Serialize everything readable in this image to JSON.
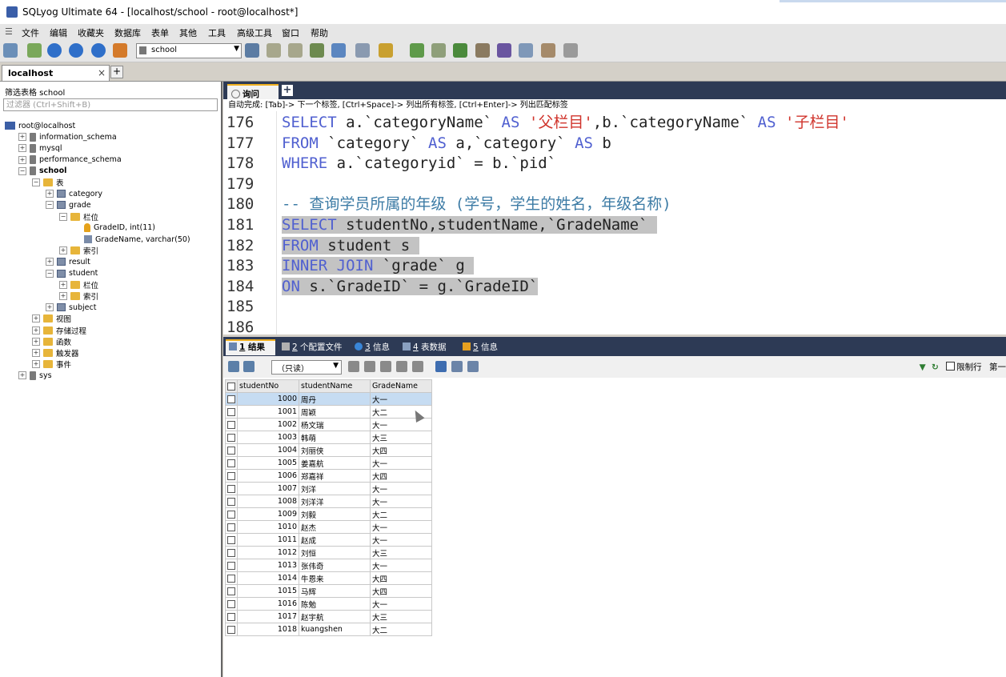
{
  "window": {
    "title": "SQLyog Ultimate 64 - [localhost/school - root@localhost*]"
  },
  "menu": [
    "文件",
    "编辑",
    "收藏夹",
    "数据库",
    "表单",
    "其他",
    "工具",
    "高级工具",
    "窗口",
    "帮助"
  ],
  "toolbar": {
    "database_select": "school"
  },
  "connection_tab": {
    "label": "localhost",
    "close": "×",
    "add": "+"
  },
  "object_browser": {
    "filter_label": "筛选表格 school",
    "filter_placeholder": "过滤器 (Ctrl+Shift+B)",
    "tree": [
      {
        "label": "root@localhost",
        "type": "server",
        "level": 0,
        "expander": "",
        "bold": false
      },
      {
        "label": "information_schema",
        "type": "db",
        "level": 1,
        "expander": "+",
        "bold": false
      },
      {
        "label": "mysql",
        "type": "db",
        "level": 1,
        "expander": "+",
        "bold": false
      },
      {
        "label": "performance_schema",
        "type": "db",
        "level": 1,
        "expander": "+",
        "bold": false
      },
      {
        "label": "school",
        "type": "db",
        "level": 1,
        "expander": "−",
        "bold": true
      },
      {
        "label": "表",
        "type": "folder",
        "level": 2,
        "expander": "−",
        "bold": false
      },
      {
        "label": "category",
        "type": "table",
        "level": 3,
        "expander": "+",
        "bold": false
      },
      {
        "label": "grade",
        "type": "table",
        "level": 3,
        "expander": "−",
        "bold": false
      },
      {
        "label": "栏位",
        "type": "folder",
        "level": 4,
        "expander": "−",
        "bold": false
      },
      {
        "label": "GradeID, int(11)",
        "type": "key",
        "level": 5,
        "expander": "",
        "bold": false
      },
      {
        "label": "GradeName, varchar(50)",
        "type": "col",
        "level": 5,
        "expander": "",
        "bold": false
      },
      {
        "label": "索引",
        "type": "folder",
        "level": 4,
        "expander": "+",
        "bold": false
      },
      {
        "label": "result",
        "type": "table",
        "level": 3,
        "expander": "+",
        "bold": false
      },
      {
        "label": "student",
        "type": "table",
        "level": 3,
        "expander": "−",
        "bold": false
      },
      {
        "label": "栏位",
        "type": "folder",
        "level": 4,
        "expander": "+",
        "bold": false
      },
      {
        "label": "索引",
        "type": "folder",
        "level": 4,
        "expander": "+",
        "bold": false
      },
      {
        "label": "subject",
        "type": "table",
        "level": 3,
        "expander": "+",
        "bold": false
      },
      {
        "label": "视图",
        "type": "folder",
        "level": 2,
        "expander": "+",
        "bold": false
      },
      {
        "label": "存储过程",
        "type": "folder",
        "level": 2,
        "expander": "+",
        "bold": false
      },
      {
        "label": "函数",
        "type": "folder",
        "level": 2,
        "expander": "+",
        "bold": false
      },
      {
        "label": "触发器",
        "type": "folder",
        "level": 2,
        "expander": "+",
        "bold": false
      },
      {
        "label": "事件",
        "type": "folder",
        "level": 2,
        "expander": "+",
        "bold": false
      },
      {
        "label": "sys",
        "type": "db",
        "level": 1,
        "expander": "+",
        "bold": false
      }
    ]
  },
  "query_tab": {
    "label": "询问",
    "add": "+"
  },
  "autocomplete_hint": "自动完成: [Tab]-> 下一个标签, [Ctrl+Space]-> 列出所有标签, [Ctrl+Enter]-> 列出匹配标签",
  "editor": {
    "lines": [
      {
        "no": "176",
        "sel": false,
        "tokens": [
          [
            "kw",
            "SELECT "
          ],
          [
            "txt",
            "a.`categoryName` "
          ],
          [
            "kw",
            "AS "
          ],
          [
            "str",
            "'父栏目'"
          ],
          [
            "txt",
            ",b.`categoryName` "
          ],
          [
            "kw",
            "AS "
          ],
          [
            "str",
            "'子栏目'"
          ]
        ]
      },
      {
        "no": "177",
        "sel": false,
        "tokens": [
          [
            "kw",
            "FROM "
          ],
          [
            "txt",
            "`category` "
          ],
          [
            "kw",
            "AS "
          ],
          [
            "txt",
            "a,`category` "
          ],
          [
            "kw",
            "AS "
          ],
          [
            "txt",
            "b"
          ]
        ]
      },
      {
        "no": "178",
        "sel": false,
        "tokens": [
          [
            "kw",
            "WHERE "
          ],
          [
            "txt",
            "a.`categoryid` = b.`pid`"
          ]
        ]
      },
      {
        "no": "179",
        "sel": false,
        "tokens": []
      },
      {
        "no": "180",
        "sel": false,
        "tokens": [
          [
            "cmt",
            "-- 查询学员所属的年级 (学号，学生的姓名，年级名称)"
          ]
        ]
      },
      {
        "no": "181",
        "sel": true,
        "tokens": [
          [
            "kw",
            "SELECT "
          ],
          [
            "txt",
            "studentNo,studentName,`GradeName` "
          ]
        ]
      },
      {
        "no": "182",
        "sel": true,
        "tokens": [
          [
            "kw",
            "FROM "
          ],
          [
            "txt",
            "student s "
          ]
        ]
      },
      {
        "no": "183",
        "sel": true,
        "tokens": [
          [
            "kw",
            "INNER JOIN "
          ],
          [
            "txt",
            "`grade` g "
          ]
        ]
      },
      {
        "no": "184",
        "sel": true,
        "tokens": [
          [
            "kw",
            "ON "
          ],
          [
            "txt",
            "s.`GradeID` = g.`GradeID`"
          ]
        ]
      },
      {
        "no": "185",
        "sel": false,
        "tokens": []
      },
      {
        "no": "186",
        "sel": false,
        "tokens": []
      }
    ]
  },
  "result_tabs": [
    {
      "num": "1",
      "label": " 结果",
      "active": true
    },
    {
      "num": "2",
      "label": " 个配置文件",
      "active": false
    },
    {
      "num": "3",
      "label": " 信息",
      "active": false
    },
    {
      "num": "4",
      "label": " 表数据",
      "active": false
    },
    {
      "num": "5",
      "label": " 信息",
      "active": false
    }
  ],
  "result_toolbar": {
    "mode": "（只读）",
    "limit_label": "限制行",
    "first_label": "第一"
  },
  "result_grid": {
    "columns": [
      "studentNo",
      "studentName",
      "GradeName"
    ],
    "rows": [
      [
        "1000",
        "周丹",
        "大一"
      ],
      [
        "1001",
        "周颖",
        "大二"
      ],
      [
        "1002",
        "杨文瑞",
        "大一"
      ],
      [
        "1003",
        "韩萌",
        "大三"
      ],
      [
        "1004",
        "刘丽侠",
        "大四"
      ],
      [
        "1005",
        "姜嘉航",
        "大一"
      ],
      [
        "1006",
        "郑嘉祥",
        "大四"
      ],
      [
        "1007",
        "刘洋",
        "大一"
      ],
      [
        "1008",
        "刘洋洋",
        "大一"
      ],
      [
        "1009",
        "刘毅",
        "大二"
      ],
      [
        "1010",
        "赵杰",
        "大一"
      ],
      [
        "1011",
        "赵成",
        "大一"
      ],
      [
        "1012",
        "刘恒",
        "大三"
      ],
      [
        "1013",
        "张伟奇",
        "大一"
      ],
      [
        "1014",
        "牛恩来",
        "大四"
      ],
      [
        "1015",
        "马辉",
        "大四"
      ],
      [
        "1016",
        "陈勉",
        "大一"
      ],
      [
        "1017",
        "赵宇航",
        "大三"
      ],
      [
        "1018",
        "kuangshen",
        "大二"
      ]
    ]
  },
  "colors": {
    "panel_header": "#2d3a55",
    "accent": "#f0b020",
    "keyword": "#5060d0",
    "string": "#d0342c",
    "comment": "#3c7ba5",
    "selection": "#c3c3c3"
  }
}
